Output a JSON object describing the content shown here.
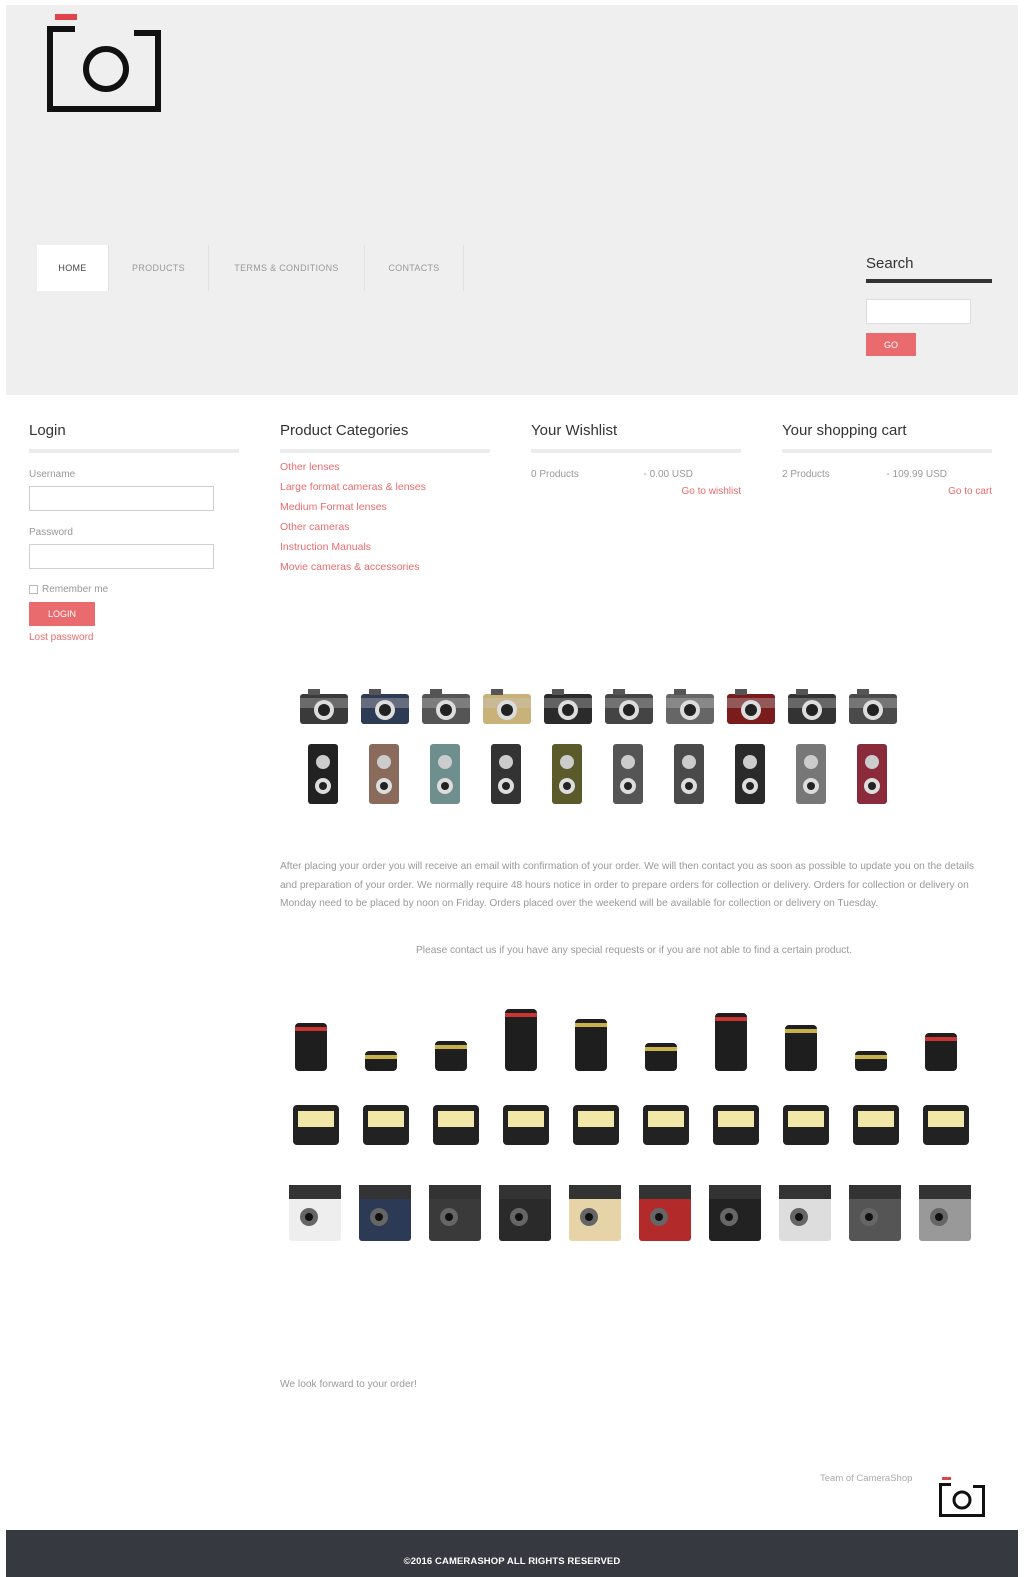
{
  "nav": [
    "HOME",
    "PRODUCTS",
    "TERMS & CONDITIONS",
    "CONTACTS"
  ],
  "search": {
    "title": "Search",
    "button": "GO"
  },
  "login": {
    "title": "Login",
    "username_label": "Username",
    "password_label": "Password",
    "remember": "Remember me",
    "button": "LOGIN",
    "lost": "Lost password"
  },
  "categories": {
    "title": "Product Categories",
    "items": [
      "Other lenses",
      "Large format cameras & lenses",
      "Medium Format lenses",
      "Other cameras",
      "Instruction Manuals",
      "Movie cameras & accessories"
    ]
  },
  "wishlist": {
    "title": "Your Wishlist",
    "count": "0 Products",
    "total": "- 0.00 USD",
    "link": "Go to wishlist"
  },
  "cart": {
    "title": "Your shopping cart",
    "count": "2 Products",
    "total": "- 109.99 USD",
    "link": "Go to cart"
  },
  "content": {
    "paragraph": "After placing your order you will receive an email with confirmation of your order. We will then contact you as soon as possible to update you on the details and preparation of your order. We normally require 48 hours notice in order to prepare orders for collection or delivery. Orders for collection or delivery on Monday need to be placed by noon on Friday. Orders placed over the weekend will be available for collection or delivery on Tuesday.",
    "contact": "Please contact us if you have any special requests or if you are not able to find a certain product.",
    "forward": "We look forward to your order!",
    "team": "Team of CameraShop"
  },
  "footer": "©2016 CAMERASHOP ALL RIGHTS RESERVED",
  "colors": {
    "accent": "#e96b6d",
    "header_bg": "#efefef",
    "footer_bg": "#363a40"
  },
  "icons": {
    "logo": "camera-bracket-logo",
    "cameras": "camera-illustration",
    "gear": "camera-accessory-illustration"
  }
}
